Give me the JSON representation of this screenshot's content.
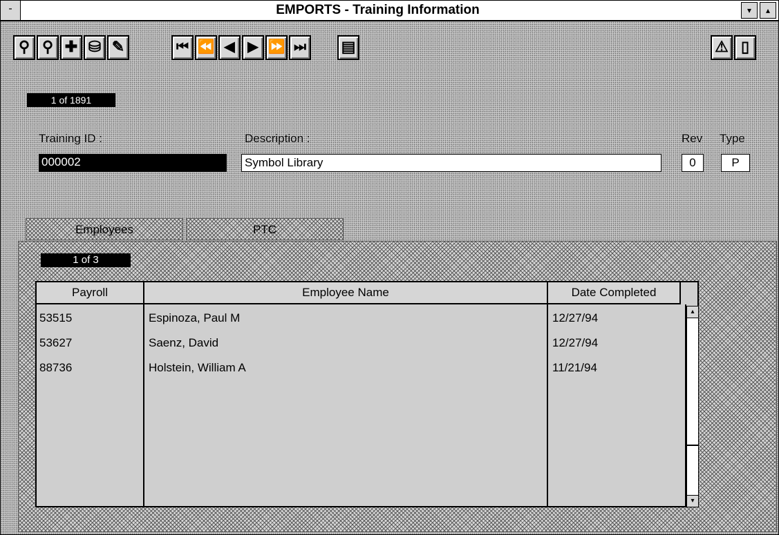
{
  "window": {
    "title": "EMPORTS - Training Information",
    "system_menu_glyph": "-",
    "minimize_glyph": "▾",
    "maximize_glyph": "▴"
  },
  "toolbar": {
    "buttons": [
      {
        "icon": "find-person-icon",
        "glyph": "⚲"
      },
      {
        "icon": "find-next-icon",
        "glyph": "⚲"
      },
      {
        "icon": "add-record-icon",
        "glyph": "✚"
      },
      {
        "icon": "database-icon",
        "glyph": "⛁"
      },
      {
        "icon": "edit-icon",
        "glyph": "✎"
      },
      {
        "icon": "first-record-icon",
        "glyph": "⏮"
      },
      {
        "icon": "rewind-icon",
        "glyph": "⏪"
      },
      {
        "icon": "previous-record-icon",
        "glyph": "◀"
      },
      {
        "icon": "next-record-icon",
        "glyph": "▶"
      },
      {
        "icon": "fast-forward-icon",
        "glyph": "⏩"
      },
      {
        "icon": "last-record-icon",
        "glyph": "⏭"
      },
      {
        "icon": "report-icon",
        "glyph": "▤"
      },
      {
        "icon": "warning-icon",
        "glyph": "⚠"
      },
      {
        "icon": "exit-icon",
        "glyph": "▯"
      }
    ]
  },
  "record_counter": "1 of 1891",
  "form": {
    "training_id_label": "Training ID :",
    "training_id_value": "000002",
    "description_label": "Description :",
    "description_value": "Symbol Library",
    "rev_label": "Rev",
    "rev_value": "0",
    "type_label": "Type",
    "type_value": "P"
  },
  "tabs": {
    "employees": "Employees",
    "ptc": "PTC"
  },
  "subform_counter": "1 of 3",
  "grid": {
    "columns": {
      "payroll": "Payroll",
      "name": "Employee Name",
      "date": "Date Completed"
    },
    "rows": [
      {
        "payroll": "53515",
        "name": "Espinoza, Paul M",
        "date": "12/27/94"
      },
      {
        "payroll": "53627",
        "name": "Saenz, David",
        "date": "12/27/94"
      },
      {
        "payroll": "88736",
        "name": "Holstein, William A",
        "date": "11/21/94"
      }
    ]
  },
  "scrollbar": {
    "up_glyph": "▴",
    "down_glyph": "▾"
  }
}
